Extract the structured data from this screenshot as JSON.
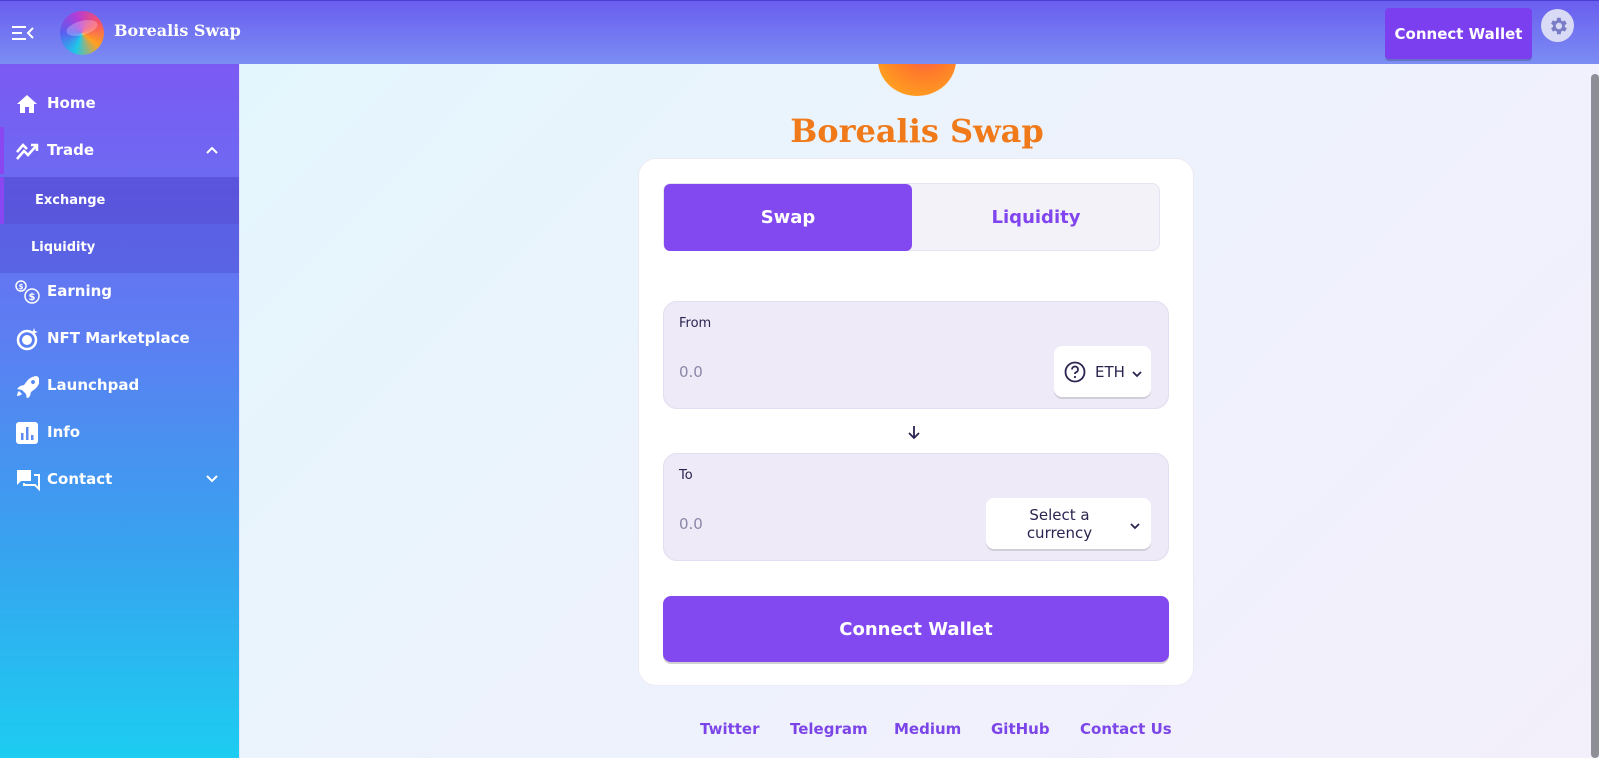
{
  "app": {
    "name": "Borealis Swap"
  },
  "header": {
    "connect_label": "Connect Wallet"
  },
  "sidebar": {
    "items": [
      {
        "label": "Home",
        "icon": "home-icon"
      },
      {
        "label": "Trade",
        "icon": "trade-icon",
        "expanded": true,
        "children": [
          {
            "label": "Exchange",
            "active": true
          },
          {
            "label": "Liquidity"
          }
        ]
      },
      {
        "label": "Earning",
        "icon": "earning-icon"
      },
      {
        "label": "NFT Marketplace",
        "icon": "nft-icon"
      },
      {
        "label": "Launchpad",
        "icon": "rocket-icon"
      },
      {
        "label": "Info",
        "icon": "chart-icon"
      },
      {
        "label": "Contact",
        "icon": "chat-icon",
        "expanded": false
      }
    ]
  },
  "main": {
    "title": "Borealis Swap",
    "tabs": [
      {
        "label": "Swap",
        "active": true
      },
      {
        "label": "Liquidity"
      }
    ],
    "from": {
      "label": "From",
      "placeholder": "0.0",
      "token": "ETH"
    },
    "to": {
      "label": "To",
      "placeholder": "0.0",
      "token": "Select a currency"
    },
    "connect_label": "Connect Wallet"
  },
  "footer": {
    "links": [
      "Twitter",
      "Telegram",
      "Medium",
      "GitHub",
      "Contact Us"
    ]
  },
  "colors": {
    "accent": "#8249f1",
    "title_orange": "#f07a1a",
    "link": "#7c45e8"
  }
}
